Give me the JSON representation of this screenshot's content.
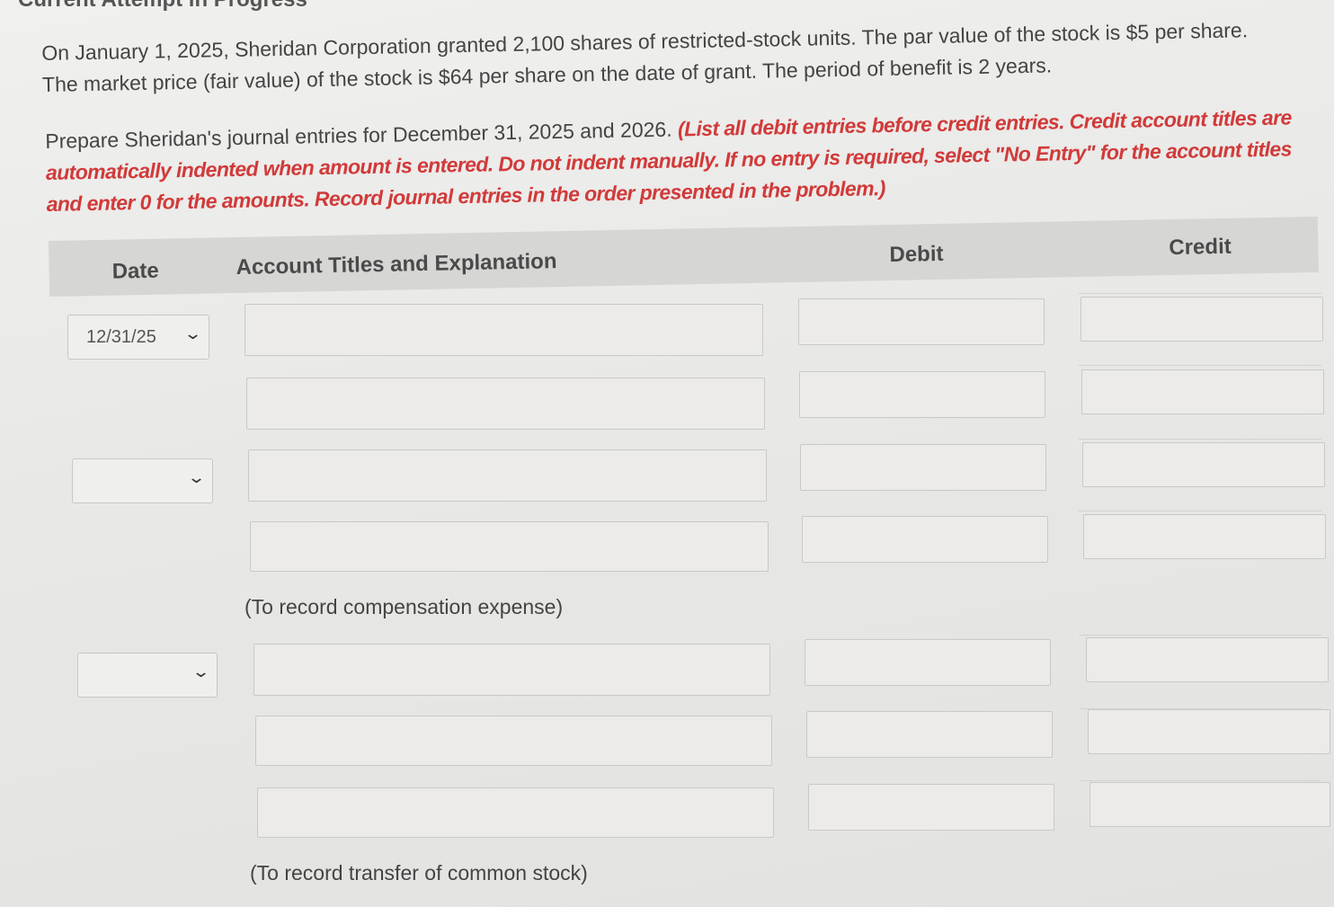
{
  "header": {
    "cut_title": "Current Attempt in Progress"
  },
  "question": {
    "line1": "On January 1, 2025, Sheridan Corporation granted 2,100 shares of restricted-stock units. The par value of the stock is $5 per share.",
    "line2": "The market price (fair value) of the stock is $64 per share on the date of grant. The period of benefit is 2 years."
  },
  "instructions": {
    "lead": "Prepare Sheridan's journal entries for December 31, 2025 and 2026. ",
    "red": "(List all debit entries before credit entries. Credit account titles are automatically indented when amount is entered. Do not indent manually. If no entry is required, select \"No Entry\" for the account titles and enter 0 for the amounts. Record journal entries in the order presented in the problem.)"
  },
  "table": {
    "headers": {
      "date": "Date",
      "account": "Account Titles and Explanation",
      "debit": "Debit",
      "credit": "Credit"
    },
    "entry1": {
      "date": "12/31/25",
      "explanation": "(To record compensation expense)"
    },
    "entry2": {
      "date": "",
      "explanation": "(To record transfer of common stock)"
    },
    "entry3": {
      "date": ""
    }
  },
  "icons": {
    "select_chevron": "chevron-down-icon"
  }
}
